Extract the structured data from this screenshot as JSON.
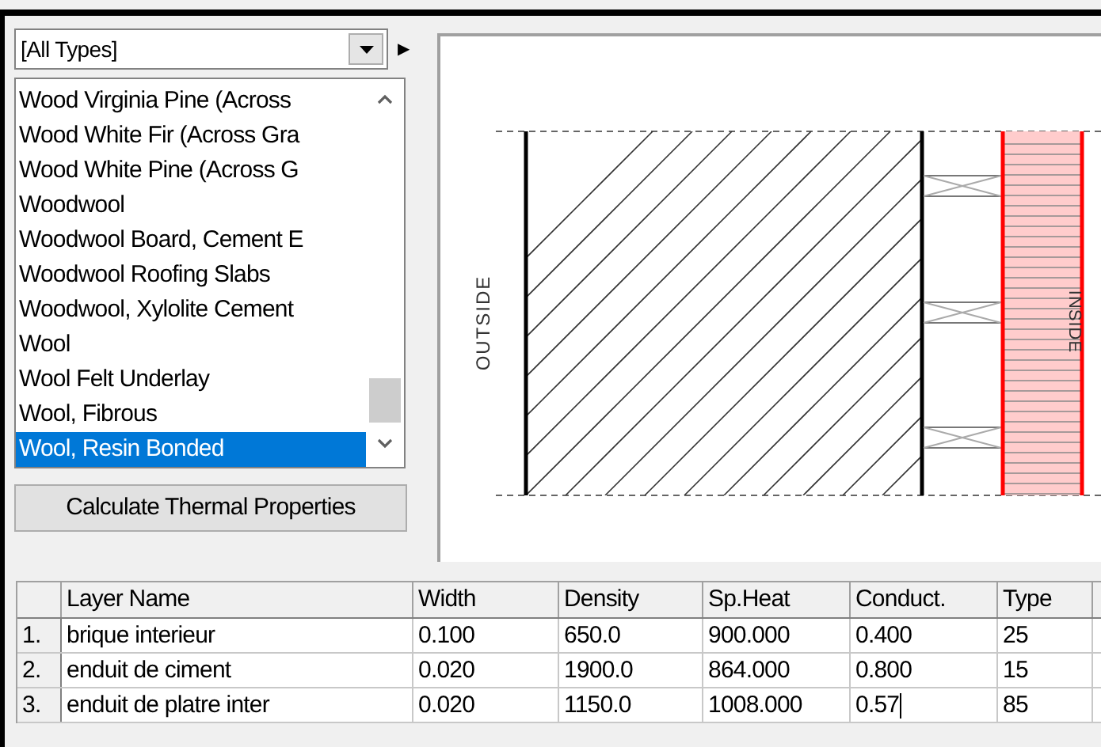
{
  "type_filter": {
    "value": "[All Types]"
  },
  "next_arrow": "▶",
  "materials": [
    {
      "label": "Wood Virginia Pine (Across",
      "selected": false
    },
    {
      "label": "Wood White Fir (Across Gra",
      "selected": false
    },
    {
      "label": "Wood White Pine (Across G",
      "selected": false
    },
    {
      "label": "Woodwool",
      "selected": false
    },
    {
      "label": "Woodwool Board, Cement E",
      "selected": false
    },
    {
      "label": "Woodwool Roofing Slabs",
      "selected": false
    },
    {
      "label": "Woodwool, Xylolite Cement",
      "selected": false
    },
    {
      "label": "Wool",
      "selected": false
    },
    {
      "label": "Wool Felt Underlay",
      "selected": false
    },
    {
      "label": "Wool, Fibrous",
      "selected": false
    },
    {
      "label": "Wool, Resin Bonded",
      "selected": true
    }
  ],
  "calculate_button": "Calculate Thermal Properties",
  "section": {
    "outside_label": "OUTSIDE",
    "inside_label": "INSIDE"
  },
  "table": {
    "columns": [
      "Layer Name",
      "Width",
      "Density",
      "Sp.Heat",
      "Conduct.",
      "Type"
    ],
    "rows": [
      {
        "index": "1.",
        "cells": [
          "brique interieur",
          "0.100",
          "650.0",
          "900.000",
          "0.400",
          "25"
        ],
        "editing": false
      },
      {
        "index": "2.",
        "cells": [
          "enduit de ciment",
          "0.020",
          "1900.0",
          "864.000",
          "0.800",
          "15"
        ],
        "editing": false
      },
      {
        "index": "3.",
        "cells": [
          "enduit de platre inter",
          "0.020",
          "1150.0",
          "1008.000",
          "0.57",
          "85"
        ],
        "editing": true
      }
    ]
  }
}
